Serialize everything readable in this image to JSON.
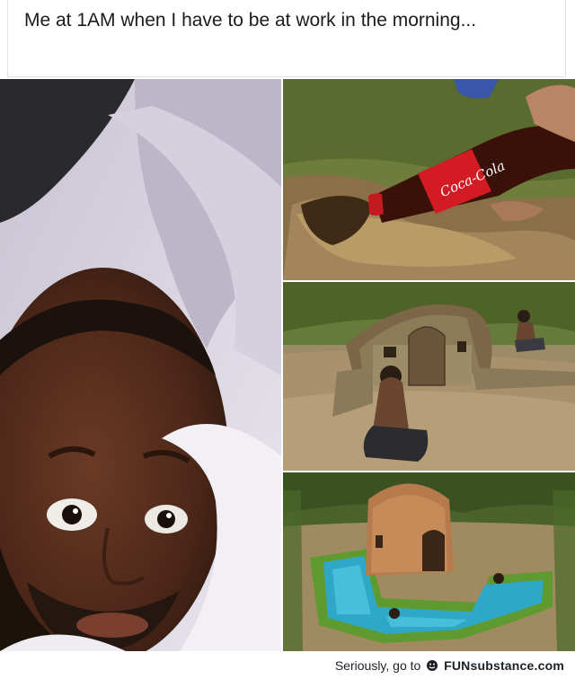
{
  "caption": "Me at 1AM when I have to be at work in the morning...",
  "bottle_label": "Coca-Cola",
  "watermark": {
    "prefix": "Seriously, go to",
    "brand": "FUNsubstance.com"
  },
  "colors": {
    "caption_text": "#1c1c1c",
    "coke_red": "#d21b22",
    "pool_water": "#2fa8c7",
    "grass": "#6f9a2f"
  }
}
